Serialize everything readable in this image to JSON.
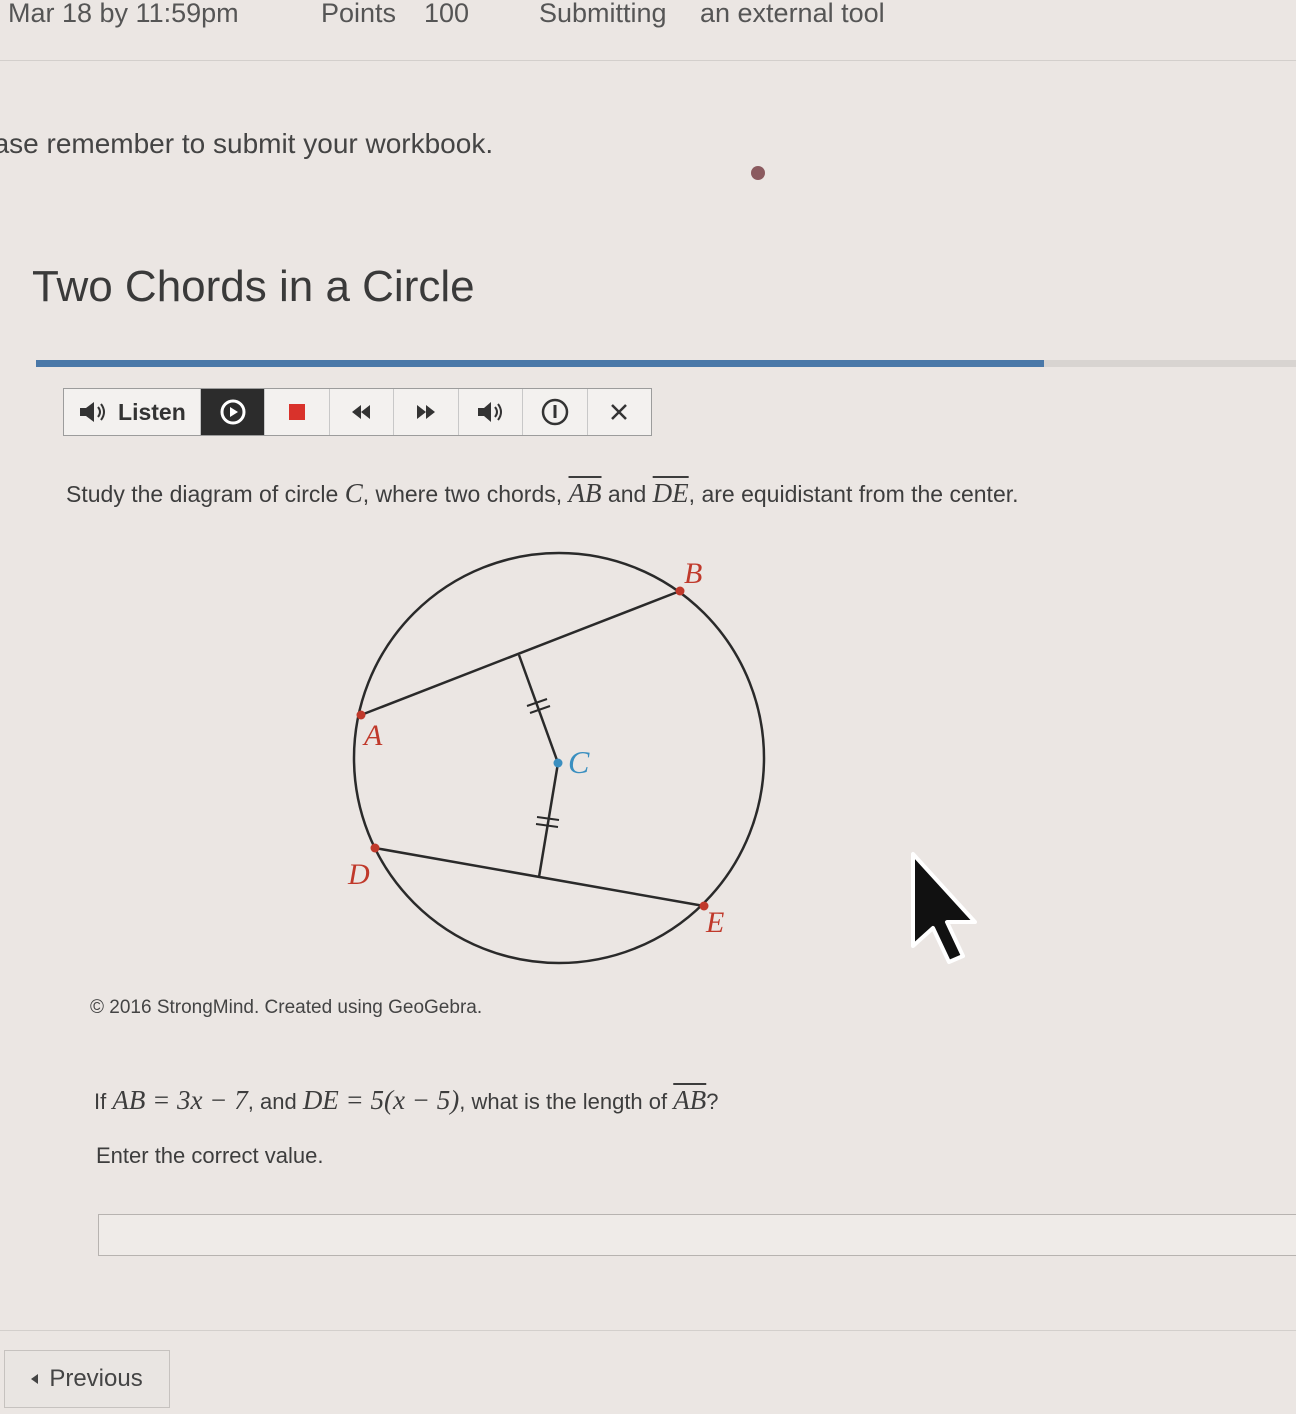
{
  "header": {
    "due": "Mar 18 by 11:59pm",
    "points_label": "Points",
    "points_value": "100",
    "submitting_label": "Submitting",
    "submitting_value": "an external tool"
  },
  "notice": "ease remember to submit your workbook.",
  "title": "Two Chords in a Circle",
  "progress_fraction": 0.8,
  "toolbar": {
    "listen_label": "Listen",
    "buttons": [
      "replay-icon",
      "stop-icon",
      "rewind-icon",
      "fast-forward-icon",
      "volume-icon",
      "info-icon",
      "close-icon"
    ]
  },
  "question": {
    "prefix": "Study the diagram of circle ",
    "circle": "C",
    "mid1": ", where two chords, ",
    "chord1": "AB",
    "mid2": " and ",
    "chord2": "DE",
    "suffix": ", are equidistant from the center."
  },
  "diagram": {
    "labels": {
      "A": "A",
      "B": "B",
      "C": "C",
      "D": "D",
      "E": "E"
    },
    "colors": {
      "circle": "#2a2a2a",
      "point": "#c0392b",
      "center": "#3a8fc0",
      "label": "#c0392b",
      "center_label": "#3a8fc0"
    }
  },
  "copyright": "© 2016 StrongMind. Created using GeoGebra.",
  "problem": {
    "if": "If ",
    "eq1": "AB = 3x − 7",
    "and": ", and ",
    "eq2": "DE = 5(x − 5)",
    "ask": ", what is the length of ",
    "target": "AB",
    "end": "?"
  },
  "instructions": "Enter the correct value.",
  "answer": {
    "value": "",
    "placeholder": ""
  },
  "nav": {
    "previous_label": "Previous"
  }
}
